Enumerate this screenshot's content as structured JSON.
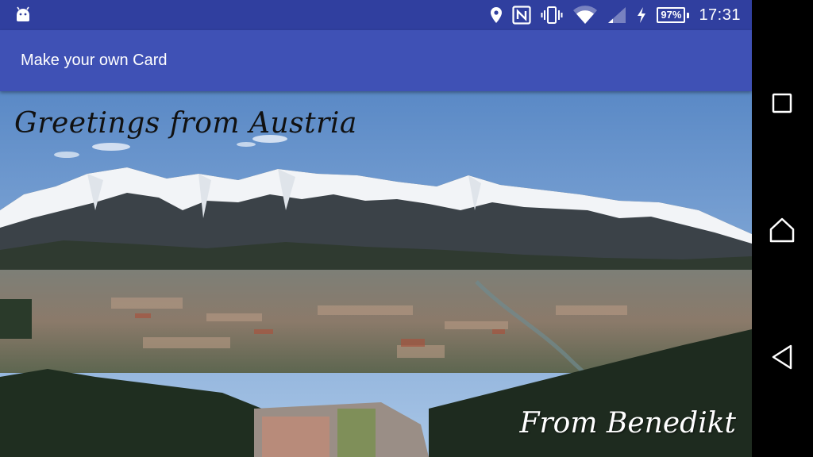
{
  "status_bar": {
    "left_icon": "android-icon",
    "icons": [
      "location-icon",
      "nfc-icon",
      "vibrate-icon",
      "wifi-icon",
      "signal-icon",
      "charging-icon"
    ],
    "battery_percent": "97%",
    "time": "17:31"
  },
  "app_bar": {
    "title": "Make your own Card"
  },
  "card": {
    "greeting": "Greetings from Austria",
    "signature": "From Benedikt"
  },
  "nav_bar": {
    "buttons": [
      "recents-button",
      "home-button",
      "back-button"
    ]
  },
  "colors": {
    "status_bar": "#303f9f",
    "app_bar": "#3f51b5",
    "sky": "#6b98cf",
    "snow": "#f2f4f7"
  }
}
